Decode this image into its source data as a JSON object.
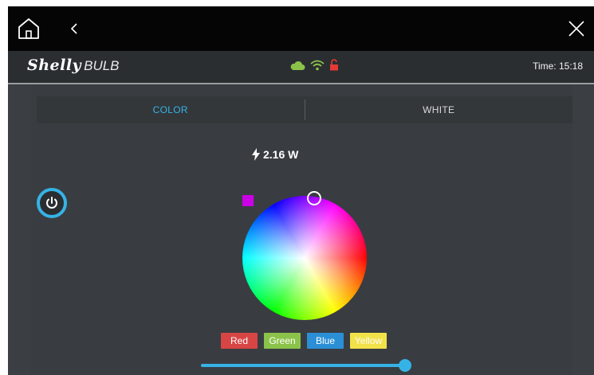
{
  "header": {
    "brand_name": "Shelly",
    "brand_product": "BULB",
    "time": "Time: 15:18"
  },
  "status_icons": [
    "cloud-icon",
    "wifi-icon",
    "lock-icon"
  ],
  "tabs": [
    {
      "label": "COLOR",
      "active": true
    },
    {
      "label": "WHITE",
      "active": false
    }
  ],
  "power_reading": "2.16 W",
  "selected_color": "#cc00e6",
  "presets": [
    {
      "label": "Red",
      "color": "#d84545"
    },
    {
      "label": "Green",
      "color": "#8bc34a"
    },
    {
      "label": "Blue",
      "color": "#2b8fd6"
    },
    {
      "label": "Yellow",
      "color": "#f2e24a"
    }
  ],
  "brightness": 1.0,
  "accent_color": "#36b3e6"
}
